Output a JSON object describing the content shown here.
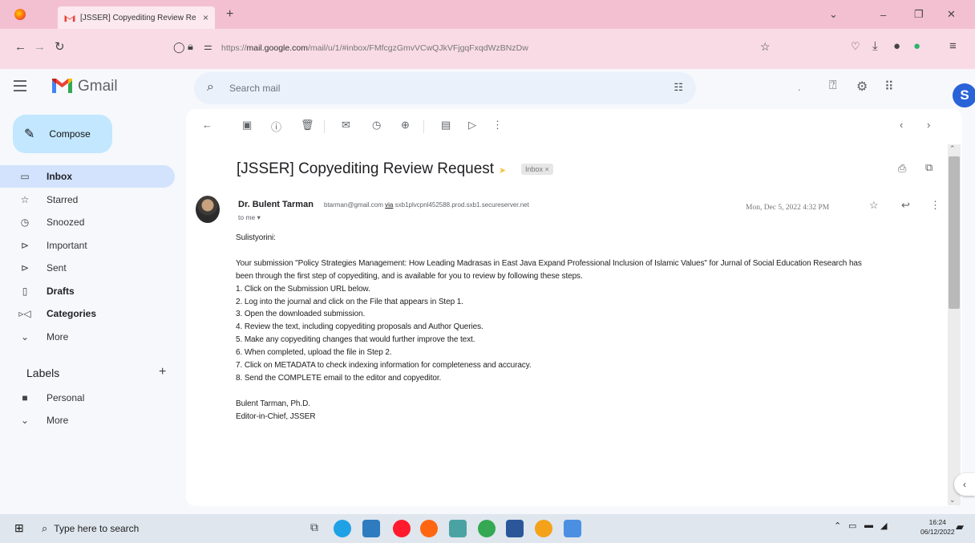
{
  "browser": {
    "tab_title": "[JSSER] Copyediting Review Re",
    "tab_close": "×",
    "new_tab": "+",
    "url_prefix": "https://",
    "url_domain": "mail.google.com",
    "url_rest": "/mail/u/1/#inbox/FMfcgzGmvVCwQJkVFjgqFxqdWzBNzDw",
    "bookmark_icon": "star-icon"
  },
  "gmail": {
    "brand": "Gmail",
    "search_placeholder": "Search mail",
    "avatar_initial": "S",
    "dot": "."
  },
  "sidebar": {
    "compose": "Compose",
    "items": [
      {
        "label": "Inbox",
        "icon": "inbox-icon",
        "glyph": "▭",
        "bold": true,
        "active": true
      },
      {
        "label": "Starred",
        "icon": "star-icon",
        "glyph": "☆",
        "bold": false,
        "active": false
      },
      {
        "label": "Snoozed",
        "icon": "clock-icon",
        "glyph": "◷",
        "bold": false,
        "active": false
      },
      {
        "label": "Important",
        "icon": "important-icon",
        "glyph": "⊳",
        "bold": false,
        "active": false
      },
      {
        "label": "Sent",
        "icon": "send-icon",
        "glyph": "⊳",
        "bold": false,
        "active": false
      },
      {
        "label": "Drafts",
        "icon": "draft-icon",
        "glyph": "▯",
        "bold": true,
        "active": false
      },
      {
        "label": "Categories",
        "icon": "label-icon",
        "glyph": "▹◁",
        "bold": true,
        "active": false
      },
      {
        "label": "More",
        "icon": "chevron-down-icon",
        "glyph": "⌄",
        "bold": false,
        "active": false
      }
    ],
    "labels_title": "Labels",
    "labels_add": "+",
    "label_items": [
      {
        "label": "Personal",
        "icon": "label-tag-icon",
        "glyph": "■"
      },
      {
        "label": "More",
        "icon": "chevron-down-icon",
        "glyph": "⌄"
      }
    ]
  },
  "message": {
    "subject": "[JSSER] Copyediting Review Request",
    "chip": "Inbox ×",
    "sender_name": "Dr. Bulent Tarman",
    "sender_email": "btarman@gmail.com",
    "via": "via",
    "via_server": "sxb1plvcpnl452588.prod.sxb1.secureserver.net",
    "to": "to me ▾",
    "date": "Mon, Dec 5, 2022 4:32 PM",
    "body": [
      "Sulistyorini:",
      "",
      "Your submission \"Policy Strategies Management: How Leading Madrasas in East Java Expand Professional Inclusion of Islamic Values\" for Jurnal of Social Education Research has",
      "been through the first step of copyediting, and is available for you to review by following these steps.",
      "1. Click on the Submission URL below.",
      "2. Log into the journal and click on the File that appears in Step 1.",
      "3. Open the downloaded submission.",
      "4. Review the text, including copyediting proposals and Author Queries.",
      "5. Make any copyediting changes that would further improve the text.",
      "6. When completed, upload the file in Step 2.",
      "7. Click on METADATA to check indexing information for completeness and accuracy.",
      "8. Send the COMPLETE email to the editor and copyeditor.",
      "",
      "Bulent Tarman, Ph.D.",
      "Editor-in-Chief, JSSER"
    ]
  },
  "taskbar": {
    "search_placeholder": "Type here to search",
    "time": "16:24",
    "date": "06/12/2022"
  }
}
